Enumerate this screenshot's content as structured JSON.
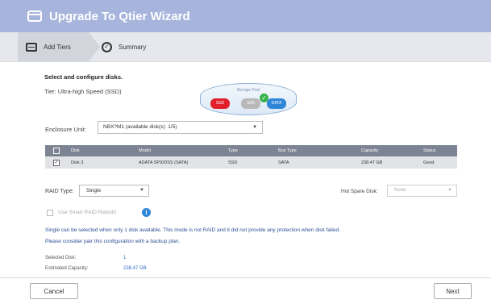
{
  "window": {
    "title": "Upgrade To Qtier Wizard"
  },
  "steps": [
    {
      "label": "Add Tiers",
      "icon": "disk-drive-icon",
      "active": true
    },
    {
      "label": "Summary",
      "icon": "check-circle-icon",
      "active": false
    }
  ],
  "main": {
    "heading": "Select and configure disks.",
    "tier": "Tier: Ultra-high Speed (SSD)",
    "pool_graphic": {
      "label": "Storage Pool",
      "tiers": [
        "SSD",
        "SAS",
        "DATA"
      ]
    },
    "enclosure": {
      "label": "Enclosure Unit:",
      "value": "NBX?M1 (available disk(s): 1/5)"
    },
    "table": {
      "columns": [
        "",
        "Disk",
        "Model",
        "Type",
        "Bus Type",
        "Capacity",
        "Status"
      ],
      "rows": [
        [
          "",
          "Disk 3",
          "ADATA SP920SS (SATA)",
          "SSD",
          "SATA",
          "238.47 GB",
          "Good"
        ]
      ]
    },
    "raid_type": {
      "label": "RAID Type:",
      "value": "Single"
    },
    "hot_spare": {
      "label": "Hot Spare Disk:",
      "value": "None"
    },
    "smart_raid": {
      "label": "Use Smart RAID Rebuild",
      "checked": false
    },
    "notes": [
      "Single can be selected when only 1 disk available. This mode is not RAID and it did not provide any protection when disk failed.",
      "Please consider pair this configuration with a backup plan."
    ],
    "summary": [
      {
        "label": "Selected Disk:",
        "value": "1"
      },
      {
        "label": "Estimated Capacity:",
        "value": "238.47 GB"
      }
    ]
  },
  "footer": {
    "cancel_label": "Cancel",
    "next_label": "Next"
  }
}
